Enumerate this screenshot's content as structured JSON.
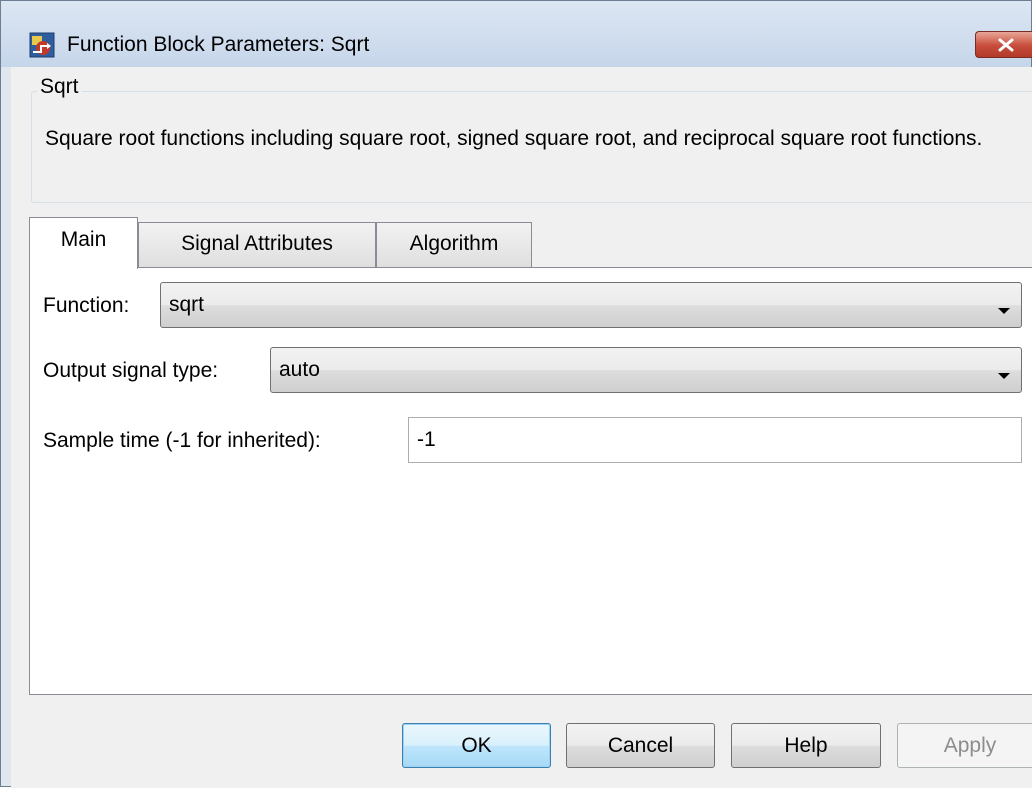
{
  "window": {
    "title": "Function Block Parameters: Sqrt",
    "icon": "simulink-block-icon",
    "close_icon": "close-x-icon"
  },
  "description": {
    "group_title": "Sqrt",
    "text": "Square root functions including square root, signed square root, and reciprocal square root functions."
  },
  "tabs": [
    {
      "label": "Main",
      "active": true
    },
    {
      "label": "Signal Attributes",
      "active": false
    },
    {
      "label": "Algorithm",
      "active": false
    }
  ],
  "main": {
    "function": {
      "label": "Function:",
      "value": "sqrt"
    },
    "output_signal_type": {
      "label": "Output signal type:",
      "value": "auto"
    },
    "sample_time": {
      "label": "Sample time (-1 for inherited):",
      "value": "-1"
    }
  },
  "buttons": {
    "ok": "OK",
    "cancel": "Cancel",
    "help": "Help",
    "apply": "Apply"
  },
  "colors": {
    "accent_default_button": "#3c7fb1",
    "close_button": "#c74c3b"
  }
}
